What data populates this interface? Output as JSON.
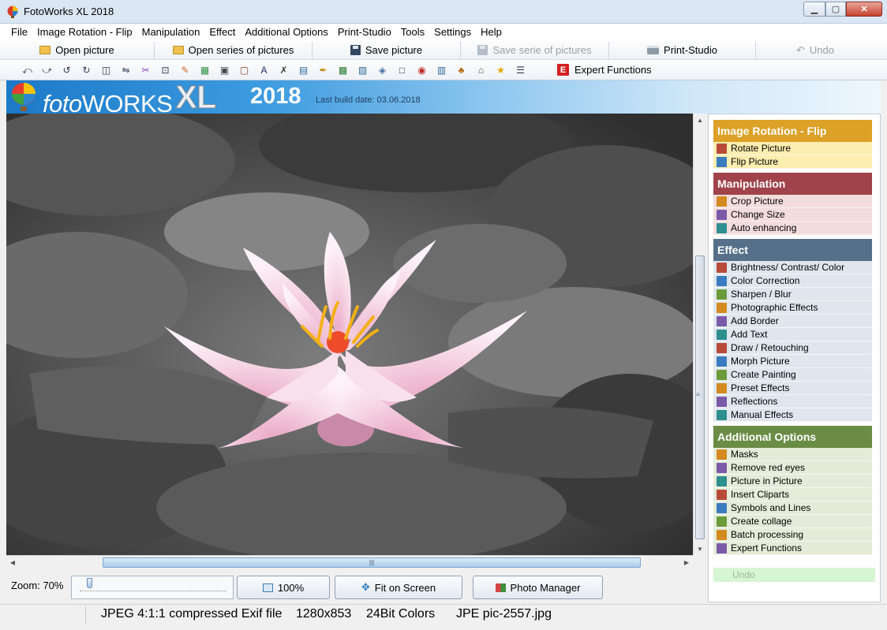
{
  "window": {
    "title": "FotoWorks XL 2018",
    "controls": {
      "minimize": "▁",
      "maximize": "▢",
      "close": "✕"
    }
  },
  "menu": [
    "File",
    "Image Rotation - Flip",
    "Manipulation",
    "Effect",
    "Additional Options",
    "Print-Studio",
    "Tools",
    "Settings",
    "Help"
  ],
  "toolbar": {
    "open_picture": "Open picture",
    "open_series": "Open series of pictures",
    "save_picture": "Save picture",
    "save_series": "Save serie of pictures",
    "print_studio": "Print-Studio",
    "undo": "Undo",
    "expert_badge": "E",
    "expert_functions": "Expert Functions"
  },
  "banner": {
    "brand_foto": "foto",
    "brand_works": "WORKS",
    "brand_xl": "XL",
    "year": "2018",
    "build_date": "Last build date: 03.06.2018"
  },
  "zoom": {
    "label": "Zoom: 70%",
    "slider_fraction": 0.05
  },
  "view_buttons": {
    "actual_size": "100%",
    "fit_screen": "Fit on Screen",
    "photo_manager": "Photo Manager"
  },
  "scroll": {
    "up": "▲",
    "down": "▼",
    "left": "◀",
    "right": "▶",
    "grip_v": "≡",
    "grip_h": "|||"
  },
  "status": {
    "format": "JPEG 4:1:1 compressed Exif file",
    "dimensions": "1280x853",
    "colors": "24Bit Colors",
    "file": "JPE pic-2557.jpg"
  },
  "sidebar": {
    "sections": [
      {
        "title": "Image Rotation - Flip",
        "header_color": "#dca126",
        "item_bg": "#fdeeb0",
        "items": [
          "Rotate Picture",
          "Flip Picture"
        ]
      },
      {
        "title": "Manipulation",
        "header_color": "#a0434b",
        "item_bg": "#f3dcdd",
        "items": [
          "Crop Picture",
          "Change Size",
          "Auto enhancing"
        ]
      },
      {
        "title": "Effect",
        "header_color": "#56708a",
        "item_bg": "#dfe6ee",
        "items": [
          "Brightness/ Contrast/ Color",
          "Color Correction",
          "Sharpen / Blur",
          "Photographic Effects",
          "Add Border",
          "Add Text",
          "Draw / Retouching",
          "Morph Picture",
          "Create Painting",
          "Preset Effects",
          "Reflections",
          "Manual Effects"
        ]
      },
      {
        "title": "Additional Options",
        "header_color": "#6a8c45",
        "item_bg": "#e4ecd9",
        "items": [
          "Masks",
          "Remove red eyes",
          "Picture in Picture",
          "Insert Cliparts",
          "Symbols and Lines",
          "Create collage",
          "Batch processing",
          "Expert Functions"
        ]
      }
    ],
    "undo": "Undo"
  },
  "tool_icons": [
    "rotate-left-icon",
    "rotate-right-icon",
    "rotate-ccw-icon",
    "rotate-cw-icon",
    "flip-3d-icon",
    "flip-icon",
    "crop-icon",
    "resize-icon",
    "enhance-icon",
    "color-icon",
    "camera-icon",
    "border-icon",
    "text-icon",
    "draw-icon",
    "morph-icon",
    "painting-icon",
    "preset-icon",
    "reflection-icon",
    "manual-icon",
    "mask-icon",
    "red-eye-icon",
    "picture-in-picture-icon",
    "clipart-icon",
    "symbols-icon",
    "collage-icon",
    "batch-icon"
  ],
  "tool_glyphs": [
    "⤺",
    "⤻",
    "↺",
    "↻",
    "◫",
    "⇋",
    "✂",
    "⊡",
    "✎",
    "▦",
    "▣",
    "▢",
    "A",
    "✗",
    "▤",
    "✒",
    "▩",
    "▨",
    "◈",
    "□",
    "◉",
    "▥",
    "♣",
    "⌂",
    "★",
    "☰"
  ]
}
